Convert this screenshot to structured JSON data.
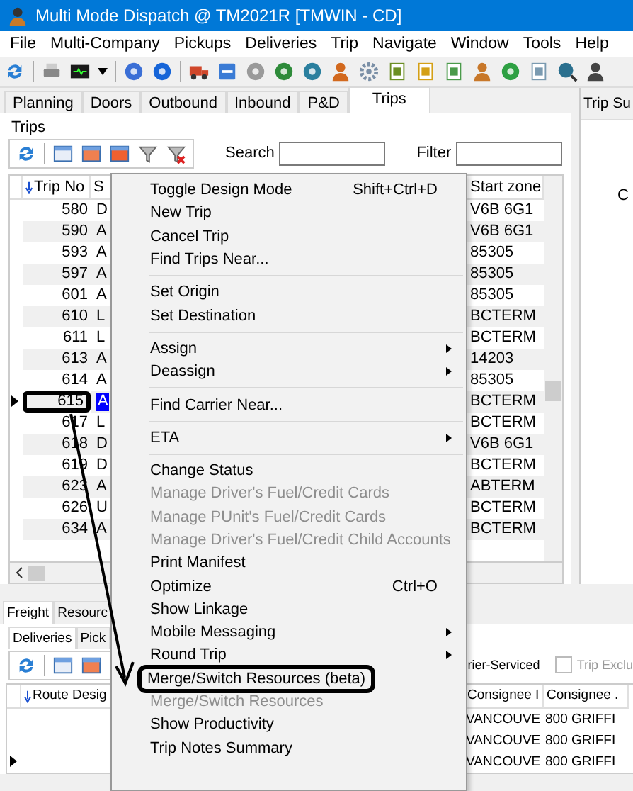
{
  "window": {
    "title": "Multi Mode Dispatch @ TM2021R [TMWIN - CD]"
  },
  "menu_bar": [
    "File",
    "Multi-Company",
    "Pickups",
    "Deliveries",
    "Trip",
    "Navigate",
    "Window",
    "Tools",
    "Help"
  ],
  "main_tabs": [
    {
      "label": "Planning",
      "selected": false
    },
    {
      "label": "Doors",
      "selected": false
    },
    {
      "label": "Outbound",
      "selected": false
    },
    {
      "label": "Inbound",
      "selected": false
    },
    {
      "label": "P&D",
      "selected": false
    },
    {
      "label": "Trips",
      "selected": true
    }
  ],
  "trips_panel": {
    "title": "Trips",
    "search_label": "Search",
    "filter_label": "Filter",
    "columns": [
      "Trip No",
      "S",
      "Start zone"
    ],
    "rows": [
      {
        "trip_no": "580",
        "status": "D",
        "start_zone": "V6B 6G1",
        "selected": false,
        "current": false,
        "annotated": false
      },
      {
        "trip_no": "590",
        "status": "A",
        "start_zone": "V6B 6G1",
        "selected": false,
        "current": false,
        "annotated": false
      },
      {
        "trip_no": "593",
        "status": "A",
        "start_zone": "85305",
        "selected": false,
        "current": false,
        "annotated": false
      },
      {
        "trip_no": "597",
        "status": "A",
        "start_zone": "85305",
        "selected": false,
        "current": false,
        "annotated": false
      },
      {
        "trip_no": "601",
        "status": "A",
        "start_zone": "85305",
        "selected": false,
        "current": false,
        "annotated": false
      },
      {
        "trip_no": "610",
        "status": "L",
        "start_zone": "BCTERM",
        "selected": false,
        "current": false,
        "annotated": false
      },
      {
        "trip_no": "611",
        "status": "L",
        "start_zone": "BCTERM",
        "selected": false,
        "current": false,
        "annotated": false
      },
      {
        "trip_no": "613",
        "status": "A",
        "start_zone": "14203",
        "selected": false,
        "current": false,
        "annotated": false
      },
      {
        "trip_no": "614",
        "status": "A",
        "start_zone": "85305",
        "selected": false,
        "current": false,
        "annotated": false
      },
      {
        "trip_no": "615",
        "status": "A",
        "start_zone": "BCTERM",
        "selected": true,
        "current": true,
        "annotated": true
      },
      {
        "trip_no": "617",
        "status": "L",
        "start_zone": "BCTERM",
        "selected": false,
        "current": false,
        "annotated": false
      },
      {
        "trip_no": "618",
        "status": "D",
        "start_zone": "V6B 6G1",
        "selected": false,
        "current": false,
        "annotated": false
      },
      {
        "trip_no": "619",
        "status": "D",
        "start_zone": "BCTERM",
        "selected": false,
        "current": false,
        "annotated": false
      },
      {
        "trip_no": "623",
        "status": "A",
        "start_zone": "ABTERM",
        "selected": false,
        "current": false,
        "annotated": false
      },
      {
        "trip_no": "626",
        "status": "U",
        "start_zone": "BCTERM",
        "selected": false,
        "current": false,
        "annotated": false
      },
      {
        "trip_no": "634",
        "status": "A",
        "start_zone": "BCTERM",
        "selected": false,
        "current": false,
        "annotated": false
      }
    ]
  },
  "right_panel": {
    "title": "Trip Su",
    "text": "C"
  },
  "freight_tabs": [
    {
      "label": "Freight",
      "selected": true
    },
    {
      "label": "Resourc",
      "selected": false
    }
  ],
  "sub_tabs": [
    {
      "label": "Deliveries",
      "selected": true
    },
    {
      "label": "Pick",
      "selected": false
    }
  ],
  "options": [
    {
      "label": "rier-Serviced",
      "disabled": false
    },
    {
      "label": "Trip Exclu",
      "checked": false,
      "disabled": true
    }
  ],
  "freight_grid": {
    "columns": [
      "Route Desig",
      "Consignee I",
      "Consignee ."
    ],
    "rows": [
      {
        "current": false,
        "cells": [
          "",
          "VANCOUVE",
          "800 GRIFFI"
        ]
      },
      {
        "current": false,
        "cells": [
          "",
          "VANCOUVE",
          "800 GRIFFI"
        ]
      },
      {
        "current": true,
        "cells": [
          "",
          "VANCOUVE",
          "800 GRIFFI"
        ]
      }
    ]
  },
  "context_menu": [
    {
      "kind": "item",
      "label": "Toggle Design Mode",
      "shortcut": "Shift+Ctrl+D",
      "submenu": false,
      "disabled": false,
      "annotated": false
    },
    {
      "kind": "item",
      "label": "New Trip",
      "submenu": false,
      "disabled": false,
      "annotated": false
    },
    {
      "kind": "item",
      "label": "Cancel Trip",
      "submenu": false,
      "disabled": false,
      "annotated": false
    },
    {
      "kind": "item",
      "label": "Find Trips Near...",
      "submenu": false,
      "disabled": false,
      "annotated": false
    },
    {
      "kind": "separator"
    },
    {
      "kind": "item",
      "label": "Set Origin",
      "submenu": false,
      "disabled": false,
      "annotated": false
    },
    {
      "kind": "item",
      "label": "Set Destination",
      "submenu": false,
      "disabled": false,
      "annotated": false
    },
    {
      "kind": "separator"
    },
    {
      "kind": "item",
      "label": "Assign",
      "submenu": true,
      "disabled": false,
      "annotated": false
    },
    {
      "kind": "item",
      "label": "Deassign",
      "submenu": true,
      "disabled": false,
      "annotated": false
    },
    {
      "kind": "separator"
    },
    {
      "kind": "item",
      "label": "Find Carrier Near...",
      "submenu": false,
      "disabled": false,
      "annotated": false
    },
    {
      "kind": "separator"
    },
    {
      "kind": "item",
      "label": "ETA",
      "submenu": true,
      "disabled": false,
      "annotated": false
    },
    {
      "kind": "separator"
    },
    {
      "kind": "item",
      "label": "Change Status",
      "submenu": false,
      "disabled": false,
      "annotated": false
    },
    {
      "kind": "item",
      "label": "Manage Driver's Fuel/Credit Cards",
      "submenu": false,
      "disabled": true,
      "annotated": false
    },
    {
      "kind": "item",
      "label": "Manage PUnit's Fuel/Credit Cards",
      "submenu": false,
      "disabled": true,
      "annotated": false
    },
    {
      "kind": "item",
      "label": "Manage Driver's Fuel/Credit Child Accounts",
      "submenu": false,
      "disabled": true,
      "annotated": false
    },
    {
      "kind": "item",
      "label": "Print Manifest",
      "submenu": false,
      "disabled": false,
      "annotated": false
    },
    {
      "kind": "item",
      "label": "Optimize",
      "shortcut": "Ctrl+O",
      "submenu": false,
      "disabled": false,
      "annotated": false
    },
    {
      "kind": "item",
      "label": "Show Linkage",
      "submenu": false,
      "disabled": false,
      "annotated": false
    },
    {
      "kind": "item",
      "label": "Mobile Messaging",
      "submenu": true,
      "disabled": false,
      "annotated": false
    },
    {
      "kind": "item",
      "label": "Round Trip",
      "submenu": true,
      "disabled": false,
      "annotated": false
    },
    {
      "kind": "item",
      "label": "Merge/Switch Resources (beta)",
      "submenu": false,
      "disabled": false,
      "annotated": true
    },
    {
      "kind": "item",
      "label": "Merge/Switch Resources",
      "submenu": false,
      "disabled": true,
      "annotated": false
    },
    {
      "kind": "item",
      "label": "Show Productivity",
      "submenu": false,
      "disabled": false,
      "annotated": false
    },
    {
      "kind": "item",
      "label": "Trip Notes Summary",
      "submenu": false,
      "disabled": false,
      "annotated": false
    }
  ]
}
